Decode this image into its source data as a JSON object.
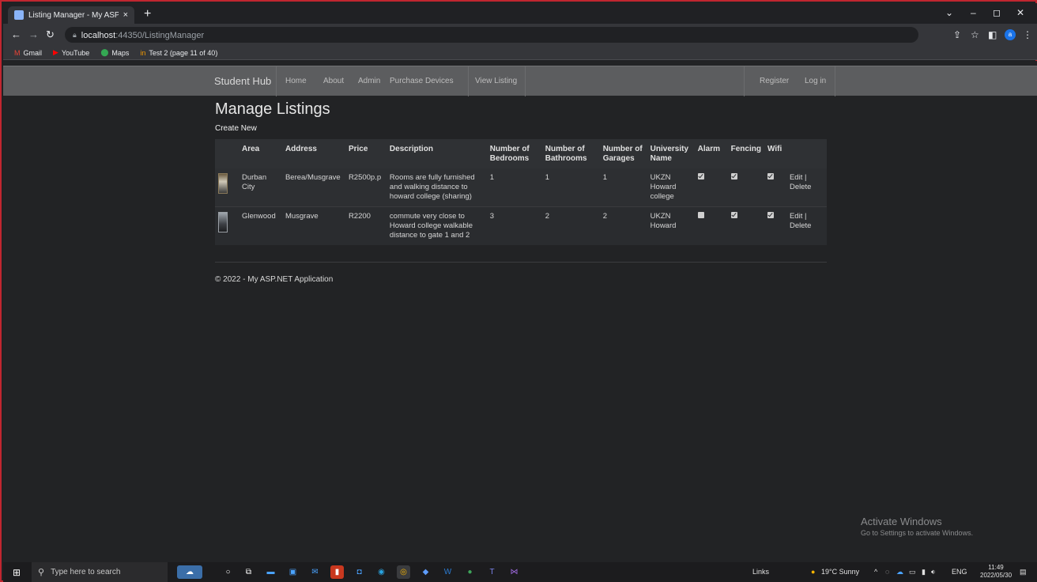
{
  "browser": {
    "tab_title": "Listing Manager - My ASP.NET A",
    "tab_close": "×",
    "new_tab": "+",
    "window_controls": [
      "⌄",
      "–",
      "◻",
      "✕"
    ],
    "url_host": "localhost",
    "url_path": ":44350/ListingManager",
    "bookmarks": [
      {
        "label": "Gmail",
        "icon": "gmail-icon",
        "glyph": "M",
        "color": "#ea4335"
      },
      {
        "label": "YouTube",
        "icon": "youtube-icon",
        "glyph": "▶",
        "color": "#ff0000"
      },
      {
        "label": "Maps",
        "icon": "maps-icon",
        "glyph": "⬤",
        "color": "#34a853"
      },
      {
        "label": "Test 2 (page 11 of 40)",
        "icon": "bookmark-site-icon",
        "glyph": "in",
        "color": "#f29900"
      }
    ],
    "profile_initial": "a"
  },
  "site": {
    "brand": "Student Hub",
    "nav": [
      "Home",
      "About",
      "Admin",
      "Purchase Devices",
      "View Listing"
    ],
    "auth": [
      "Register",
      "Log in"
    ]
  },
  "page": {
    "title": "Manage Listings",
    "create_new": "Create New",
    "footer": "© 2022 - My ASP.NET Application"
  },
  "table": {
    "headers": [
      "",
      "Area",
      "Address",
      "Price",
      "Description",
      "Number of Bedrooms",
      "Number of Bathrooms",
      "Number of Garages",
      "University Name",
      "Alarm",
      "Fencing",
      "Wifi",
      ""
    ],
    "rows": [
      {
        "area": "Durban City",
        "address": "Berea/Musgrave",
        "price": "R2500p.p",
        "description": "Rooms are fully furnished and walking distance to howard college (sharing)",
        "bedrooms": "1",
        "bathrooms": "1",
        "garages": "1",
        "university": "UKZN Howard college",
        "alarm": true,
        "fencing": true,
        "wifi": true,
        "edit": "Edit |",
        "delete": "Delete"
      },
      {
        "area": "Glenwood",
        "address": "Musgrave",
        "price": "R2200",
        "description": "commute very close to Howard college walkable distance to gate 1 and 2",
        "bedrooms": "3",
        "bathrooms": "2",
        "garages": "2",
        "university": "UKZN Howard",
        "alarm": false,
        "fencing": true,
        "wifi": true,
        "edit": "Edit |",
        "delete": "Delete"
      }
    ]
  },
  "watermark": {
    "line1": "Activate Windows",
    "line2": "Go to Settings to activate Windows."
  },
  "taskbar": {
    "search_placeholder": "Type here to search",
    "links_label": "Links",
    "weather": "19°C Sunny",
    "language": "ENG",
    "time": "11:49",
    "date": "2022/05/30"
  }
}
